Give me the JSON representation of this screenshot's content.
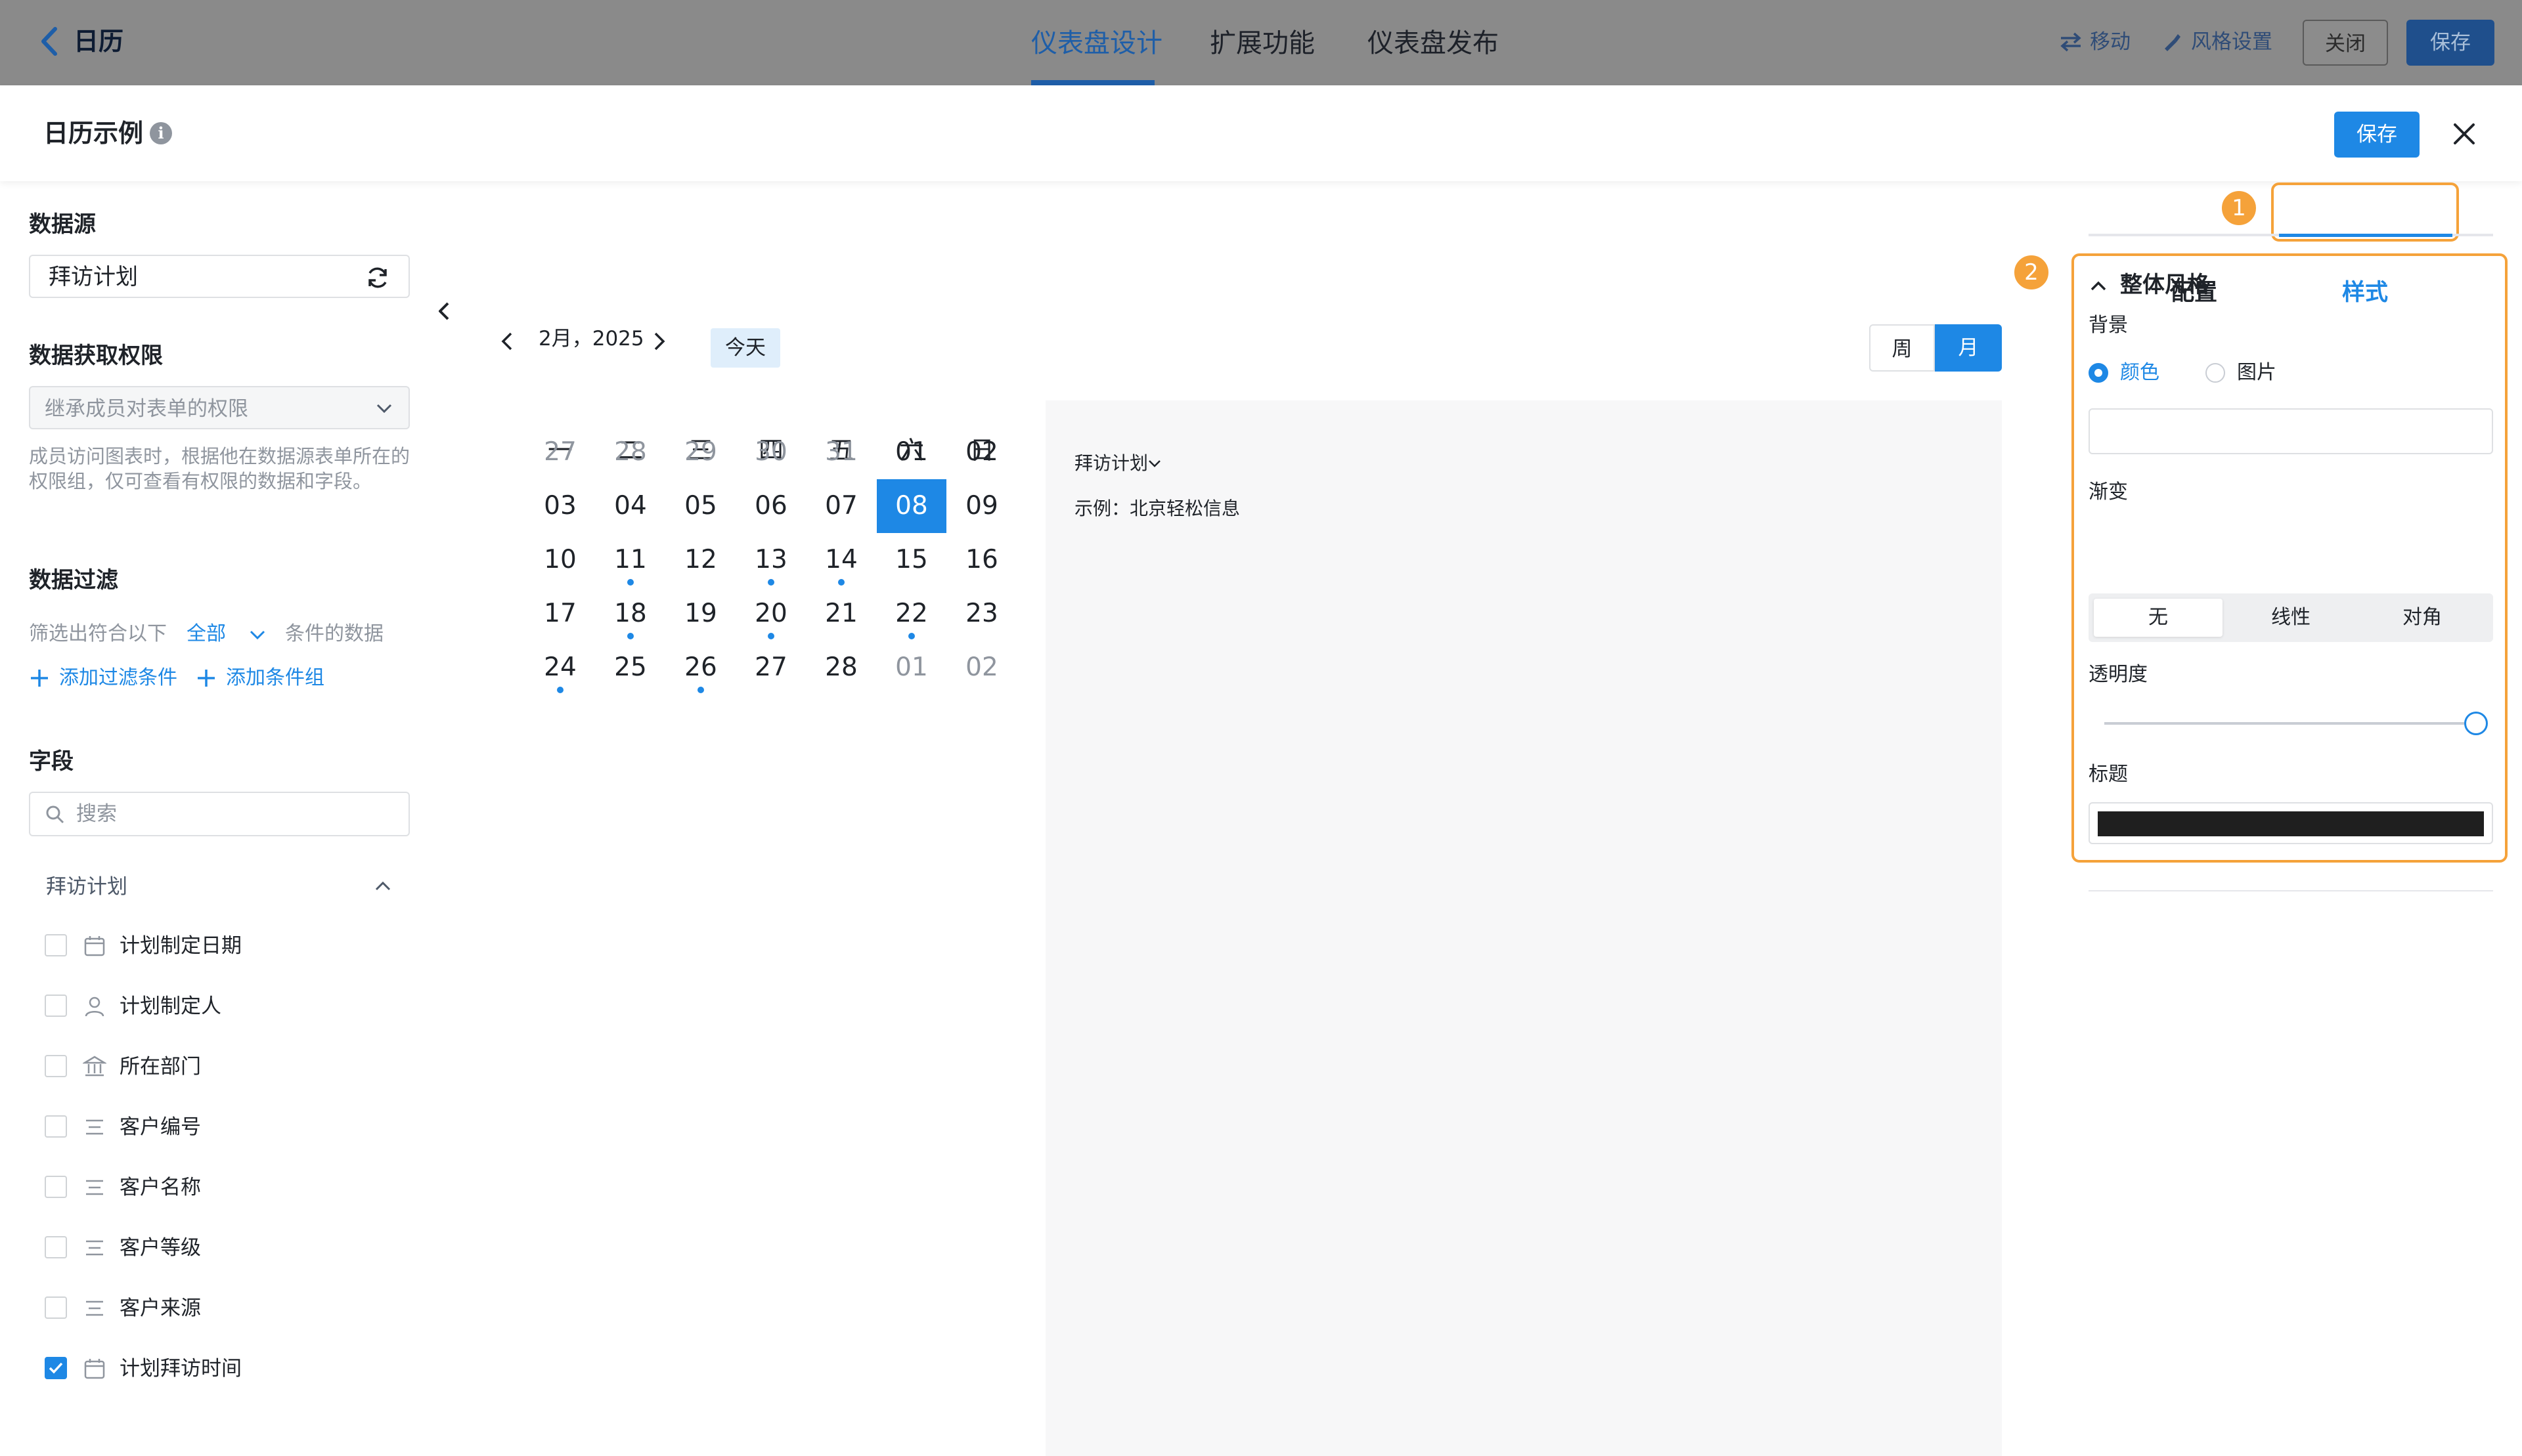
{
  "topbar": {
    "title": "日历",
    "tabs": [
      "仪表盘设计",
      "扩展功能",
      "仪表盘发布"
    ],
    "move_label": "移动",
    "style_settings_label": "风格设置",
    "close_label": "关闭",
    "save_label": "保存"
  },
  "modal": {
    "title": "日历示例",
    "save_label": "保存"
  },
  "left": {
    "datasource_title": "数据源",
    "datasource_value": "拜访计划",
    "permission_title": "数据获取权限",
    "permission_value": "继承成员对表单的权限",
    "permission_hint": "成员访问图表时，根据他在数据源表单所在的权限组，仅可查看有权限的数据和字段。",
    "filter_title": "数据过滤",
    "filter_prefix": "筛选出符合以下",
    "filter_mode": "全部",
    "filter_suffix": "条件的数据",
    "add_filter": "添加过滤条件",
    "add_group": "添加条件组",
    "fields_title": "字段",
    "search_placeholder": "搜索",
    "group_name": "拜访计划",
    "fields": [
      {
        "label": "计划制定日期",
        "icon": "calendar-icon",
        "checked": false
      },
      {
        "label": "计划制定人",
        "icon": "person-icon",
        "checked": false
      },
      {
        "label": "所在部门",
        "icon": "department-icon",
        "checked": false
      },
      {
        "label": "客户编号",
        "icon": "text-field-icon",
        "checked": false
      },
      {
        "label": "客户名称",
        "icon": "text-field-icon",
        "checked": false
      },
      {
        "label": "客户等级",
        "icon": "text-field-icon",
        "checked": false
      },
      {
        "label": "客户来源",
        "icon": "text-field-icon",
        "checked": false
      },
      {
        "label": "计划拜访时间",
        "icon": "calendar-icon",
        "checked": true
      }
    ]
  },
  "calendar": {
    "month_label": "2月，2025",
    "today_label": "今天",
    "week_label": "周",
    "month_view_label": "月",
    "weekdays": [
      "一",
      "二",
      "三",
      "四",
      "五",
      "六",
      "日"
    ],
    "weeks": [
      [
        {
          "d": "27",
          "o": true
        },
        {
          "d": "28",
          "o": true
        },
        {
          "d": "29",
          "o": true
        },
        {
          "d": "30",
          "o": true
        },
        {
          "d": "31",
          "o": true
        },
        {
          "d": "01"
        },
        {
          "d": "02"
        }
      ],
      [
        {
          "d": "03"
        },
        {
          "d": "04"
        },
        {
          "d": "05"
        },
        {
          "d": "06"
        },
        {
          "d": "07"
        },
        {
          "d": "08",
          "sel": true
        },
        {
          "d": "09"
        }
      ],
      [
        {
          "d": "10"
        },
        {
          "d": "11",
          "dot": true
        },
        {
          "d": "12"
        },
        {
          "d": "13",
          "dot": true
        },
        {
          "d": "14",
          "dot": true
        },
        {
          "d": "15"
        },
        {
          "d": "16"
        }
      ],
      [
        {
          "d": "17"
        },
        {
          "d": "18",
          "dot": true
        },
        {
          "d": "19"
        },
        {
          "d": "20",
          "dot": true
        },
        {
          "d": "21"
        },
        {
          "d": "22",
          "dot": true
        },
        {
          "d": "23"
        }
      ],
      [
        {
          "d": "24",
          "dot": true
        },
        {
          "d": "25"
        },
        {
          "d": "26",
          "dot": true
        },
        {
          "d": "27"
        },
        {
          "d": "28"
        },
        {
          "d": "01",
          "o": true
        },
        {
          "d": "02",
          "o": true
        }
      ]
    ],
    "event_source": "拜访计划",
    "event_example": "示例：北京轻松信息"
  },
  "right": {
    "tab_config": "配置",
    "tab_style": "样式",
    "badge_1": "1",
    "badge_2": "2",
    "section_title": "整体风格",
    "background_label": "背景",
    "bg_color_option": "颜色",
    "bg_image_option": "图片",
    "gradient_label": "渐变",
    "gradient_options": [
      "无",
      "线性",
      "对角"
    ],
    "opacity_label": "透明度",
    "opacity_value": 1.0,
    "title_label": "标题",
    "title_color": "#1f1f1f"
  },
  "colors": {
    "primary": "#1e88e5",
    "highlight": "#f5a23a",
    "nav_active": "#1e5ea8"
  }
}
